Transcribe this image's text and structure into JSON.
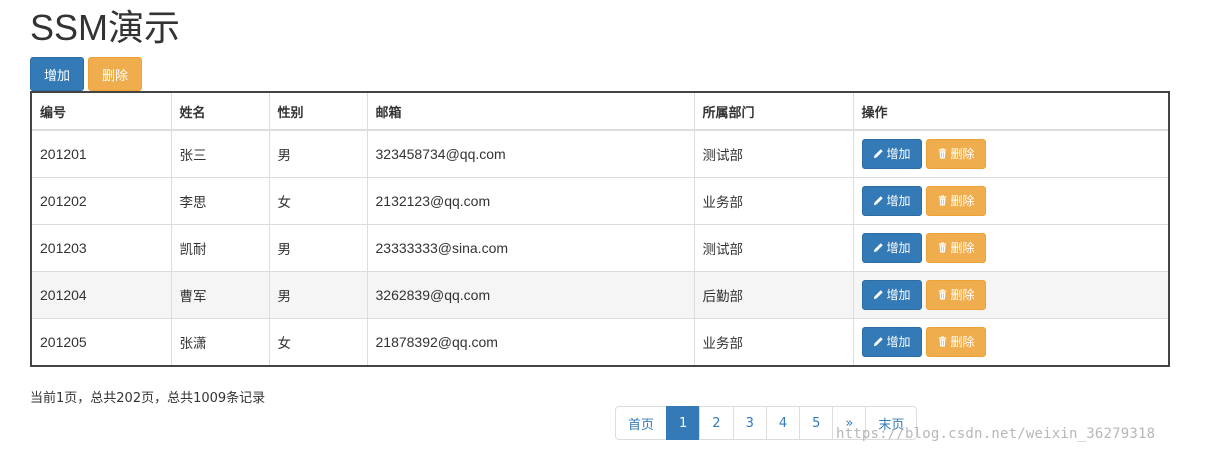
{
  "title": "SSM演示",
  "toolbar": {
    "add_label": "增加",
    "delete_label": "删除"
  },
  "table": {
    "headers": [
      "编号",
      "姓名",
      "性别",
      "邮箱",
      "所属部门",
      "操作"
    ],
    "rows": [
      {
        "id": "201201",
        "name": "张三",
        "gender": "男",
        "email": "323458734@qq.com",
        "dept": "测试部",
        "edit": "增加",
        "del": "删除"
      },
      {
        "id": "201202",
        "name": "李思",
        "gender": "女",
        "email": "2132123@qq.com",
        "dept": "业务部",
        "edit": "增加",
        "del": "删除"
      },
      {
        "id": "201203",
        "name": "凯耐",
        "gender": "男",
        "email": "23333333@sina.com",
        "dept": "测试部",
        "edit": "增加",
        "del": "删除"
      },
      {
        "id": "201204",
        "name": "曹军",
        "gender": "男",
        "email": "3262839@qq.com",
        "dept": "后勤部",
        "edit": "增加",
        "del": "删除"
      },
      {
        "id": "201205",
        "name": "张潇",
        "gender": "女",
        "email": "21878392@qq.com",
        "dept": "业务部",
        "edit": "增加",
        "del": "删除"
      }
    ]
  },
  "page_info": "当前1页，总共202页，总共1009条记录",
  "pagination": {
    "first": "首页",
    "pages": [
      "1",
      "2",
      "3",
      "4",
      "5"
    ],
    "active_page": "1",
    "next": "»",
    "last": "末页"
  },
  "watermark": "https://blog.csdn.net/weixin_36279318",
  "colors": {
    "primary": "#337ab7",
    "warning": "#f0ad4e",
    "border_dark": "#444444"
  },
  "icons": {
    "edit": "pencil-icon",
    "delete": "trash-icon"
  }
}
